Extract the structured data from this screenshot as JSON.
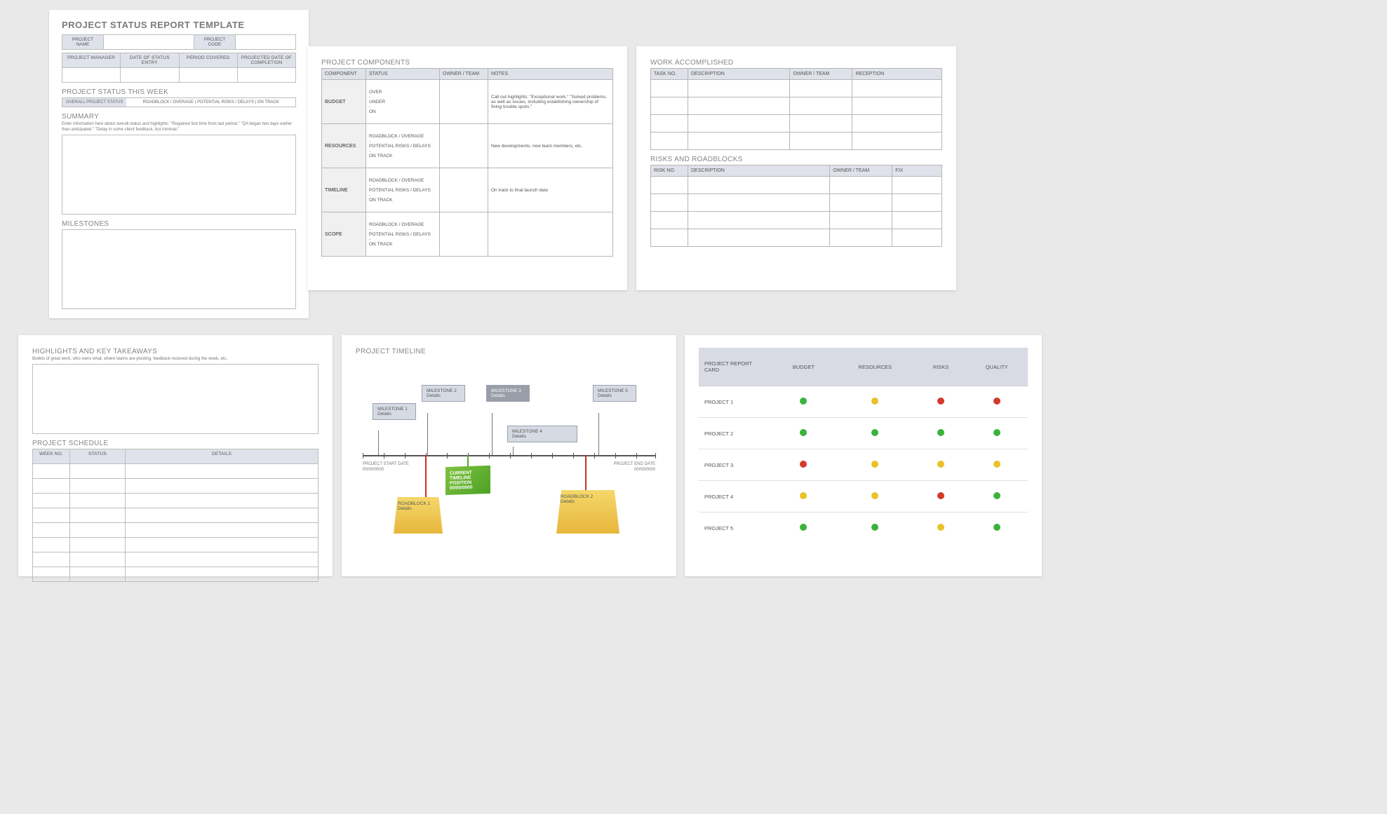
{
  "page1": {
    "title": "PROJECT STATUS REPORT TEMPLATE",
    "projectNameLabel": "PROJECT NAME",
    "projectCodeLabel": "PROJECT CODE",
    "row2": [
      "PROJECT MANAGER",
      "DATE OF STATUS ENTRY",
      "PERIOD COVERED",
      "PROJECTED DATE OF COMPLETION"
    ],
    "statusWeek": "PROJECT STATUS THIS WEEK",
    "overallLabel": "OVERALL PROJECT STATUS",
    "statusOptions": "ROADBLOCK / OVERAGE   |   POTENTIAL RISKS / DELAYS   |   ON TRACK",
    "summary": "SUMMARY",
    "summaryHint": "Enter information here about overall status and highlights: \"Regained lost time from last period.\" \"QA began two days earlier than anticipated.\" \"Delay in some client feedback, but minimal.\"",
    "milestones": "MILESTONES"
  },
  "page2": {
    "title": "PROJECT COMPONENTS",
    "headers": [
      "COMPONENT",
      "STATUS",
      "OWNER / TEAM",
      "NOTES"
    ],
    "rows": [
      {
        "name": "BUDGET",
        "status": "OVER\n-\nUNDER\n-\nON",
        "notes": "Call out highlights: \"Exceptional work.\" \"Solved problems, as well as issues, including establishing ownership of fixing trouble spots.\""
      },
      {
        "name": "RESOURCES",
        "status": "ROADBLOCK / OVERAGE\n-\nPOTENTIAL RISKS / DELAYS\n-\nON TRACK",
        "notes": "New developments, new team members, etc."
      },
      {
        "name": "TIMELINE",
        "status": "ROADBLOCK / OVERAGE\n-\nPOTENTIAL RISKS / DELAYS\n-\nON TRACK",
        "notes": "On track to final launch date"
      },
      {
        "name": "SCOPE",
        "status": "ROADBLOCK / OVERAGE\n-\nPOTENTIAL RISKS / DELAYS\n-\nON TRACK",
        "notes": ""
      }
    ]
  },
  "page3": {
    "workTitle": "WORK ACCOMPLISHED",
    "workHeaders": [
      "TASK NO.",
      "DESCRIPTION",
      "OWNER / TEAM",
      "RECEPTION"
    ],
    "risksTitle": "RISKS AND ROADBLOCKS",
    "risksHeaders": [
      "RISK NO.",
      "DESCRIPTION",
      "OWNER / TEAM",
      "FIX"
    ]
  },
  "page4": {
    "highlights": "HIGHLIGHTS AND KEY TAKEAWAYS",
    "highlightsHint": "Bullets of great work, who owns what, where teams are pivoting, feedback received during the week, etc.",
    "schedule": "PROJECT SCHEDULE",
    "schedHeaders": [
      "WEEK NO.",
      "STATUS",
      "DETAILS"
    ]
  },
  "page5": {
    "title": "PROJECT TIMELINE",
    "start": "PROJECT START DATE\n00/00/0000",
    "end": "PROJECT END DATE\n00/00/0000",
    "m1": "MILESTONE 1\nDetails",
    "m2": "MILESTONE 2\nDetails",
    "m3": "MILESTONE 3\nDetails",
    "m4": "MILESTONE 4\nDetails",
    "m5": "MILESTONE 5\nDetails",
    "current": "CURRENT TIMELINE POSITION 00/00/0000",
    "rb1": "ROADBLOCK 1\nDetails",
    "rb2": "ROADBLOCK 2\nDetails"
  },
  "page6": {
    "headers": [
      "PROJECT REPORT CARD",
      "BUDGET",
      "RESOURCES",
      "RISKS",
      "QUALITY"
    ],
    "rows": [
      {
        "name": "PROJECT 1",
        "cells": [
          "g",
          "y",
          "r",
          "r"
        ]
      },
      {
        "name": "PROJECT 2",
        "cells": [
          "g",
          "g",
          "g",
          "g"
        ]
      },
      {
        "name": "PROJECT 3",
        "cells": [
          "r",
          "y",
          "y",
          "y"
        ]
      },
      {
        "name": "PROJECT 4",
        "cells": [
          "y",
          "y",
          "r",
          "g"
        ]
      },
      {
        "name": "PROJECT 5",
        "cells": [
          "g",
          "g",
          "y",
          "g"
        ]
      }
    ]
  }
}
